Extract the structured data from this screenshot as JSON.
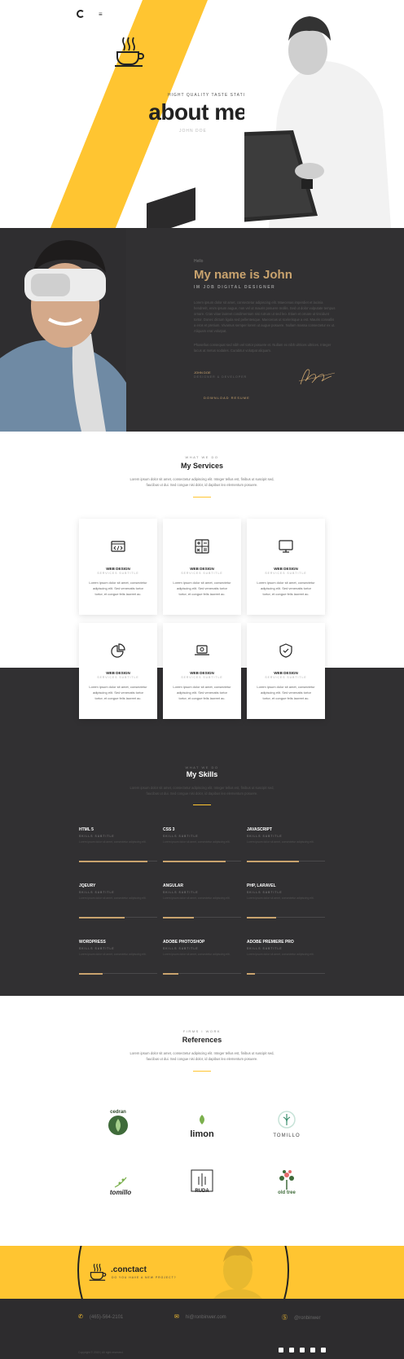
{
  "hero": {
    "menu_icon": "≡",
    "tagline": "HIGHT QUALITY TASTE STATION",
    "title_dot": ".",
    "title": "about me",
    "subtitle": "JOHN DOE"
  },
  "about": {
    "hello": "Hello",
    "name": "My name is John",
    "role": "IM JOB DIGITAL DESIGNER",
    "para1": "Lorem ipsum dolor sit amet, consectetur adipiscing elit. Maecenas imperdiet et lacinia hendrerit, enim ipsum augue, non vel ut mauris posuere mollis. Sed ut dolor vulputate tempus ornare. Cras vitae laoreet condimentum nisi rutrum ut sed leo. Etiam et ornare ut tincidunt tortor. Donec dictum ligula sed pellentesque. Maecenas ut scelerisque a est. Mauris convallis a eros et pretium. Vivamus semper lorem ut augue posuere. Nullam massa consectetur ex ut. Aliquam erat volutpat.",
    "para2": "Phasellus consequat sed nibh vel tortor posuere et. Nullam ex nibh ultrices ultrices. Integer lacus at metus sodales. Curabitur volutpat aliquam.",
    "sig_name": "JOHN DOE",
    "sig_role": "DESIGNER & DEVELOPER",
    "download": "DOWNLOAD RESUME"
  },
  "services": {
    "kicker": "WHAT WE DO",
    "title": "My Services",
    "desc": "Lorem ipsum dolor sit amet, consectetur adipiscing elit. Integer tellus est, finibus ut suscipit sed, faucibus ut dui. Sed congue nisi dolor, id dapibus leo elementum posuere.",
    "items": [
      {
        "icon": "code-icon",
        "title": "WEB DESIGN",
        "subtitle": "SERVICES SUBTITLE",
        "desc": "Lorem ipsum dolor sit amet, consectetur adipiscing elit. Sed venenatis tortor tortor, et congue felis laoreet ac."
      },
      {
        "icon": "calculator-icon",
        "title": "WEB DESIGN",
        "subtitle": "SERVICES SUBTITLE",
        "desc": "Lorem ipsum dolor sit amet, consectetur adipiscing elit. Sed venenatis tortor tortor, et congue felis laoreet ac."
      },
      {
        "icon": "monitor-icon",
        "title": "WEB DESIGN",
        "subtitle": "SERVICES SUBTITLE",
        "desc": "Lorem ipsum dolor sit amet, consectetur adipiscing elit. Sed venenatis tortor tortor, et congue felis laoreet ac."
      },
      {
        "icon": "pie-chart-icon",
        "title": "WEB DESIGN",
        "subtitle": "SERVICES SUBTITLE",
        "desc": "Lorem ipsum dolor sit amet, consectetur adipiscing elit. Sed venenatis tortor tortor, et congue felis laoreet ac."
      },
      {
        "icon": "laptop-gear-icon",
        "title": "WEB DESIGN",
        "subtitle": "SERVICES SUBTITLE",
        "desc": "Lorem ipsum dolor sit amet, consectetur adipiscing elit. Sed venenatis tortor tortor, et congue felis laoreet ac."
      },
      {
        "icon": "shield-check-icon",
        "title": "WEB DESIGN",
        "subtitle": "SERVICES SUBTITLE",
        "desc": "Lorem ipsum dolor sit amet, consectetur adipiscing elit. Sed venenatis tortor tortor, et congue felis laoreet ac."
      }
    ]
  },
  "skills": {
    "kicker": "WHAT WE DO",
    "title": "My Skills",
    "desc": "Lorem ipsum dolor sit amet, consectetur adipiscing elit. Integer tellus est, finibus ut suscipit sed, faucibus ut dui. Sed congue nisi dolor, id dapibus leo elementum posuere.",
    "items": [
      {
        "name": "HTML 5",
        "subtitle": "SKILLS SUBTITLE",
        "desc": "Lorem ipsum dolor sit amet, consectetur adipiscing elit.",
        "level": 0.88
      },
      {
        "name": "CSS 3",
        "subtitle": "SKILLS SUBTITLE",
        "desc": "Lorem ipsum dolor sit amet, consectetur adipiscing elit.",
        "level": 0.8
      },
      {
        "name": "JAVASCRIPT",
        "subtitle": "SKILLS SUBTITLE",
        "desc": "Lorem ipsum dolor sit amet, consectetur adipiscing elit.",
        "level": 0.67
      },
      {
        "name": "JQEURY",
        "subtitle": "SKILLS SUBTITLE",
        "desc": "Lorem ipsum dolor sit amet, consectetur adipiscing elit.",
        "level": 0.58
      },
      {
        "name": "ANGULAR",
        "subtitle": "SKILLS SUBTITLE",
        "desc": "Lorem ipsum dolor sit amet, consectetur adipiscing elit.",
        "level": 0.4
      },
      {
        "name": "PHP, LARAVEL",
        "subtitle": "SKILLS SUBTITLE",
        "desc": "Lorem ipsum dolor sit amet, consectetur adipiscing elit.",
        "level": 0.38
      },
      {
        "name": "WORDPRESS",
        "subtitle": "SKILLS SUBTITLE",
        "desc": "Lorem ipsum dolor sit amet, consectetur adipiscing elit.",
        "level": 0.3
      },
      {
        "name": "ADOBE PHOTOSHOP",
        "subtitle": "SKILLS SUBTITLE",
        "desc": "Lorem ipsum dolor sit amet, consectetur adipiscing elit.",
        "level": 0.2
      },
      {
        "name": "ADOBE PREMIERE PRO",
        "subtitle": "SKILLS SUBTITLE",
        "desc": "Lorem ipsum dolor sit amet, consectetur adipiscing elit.",
        "level": 0.1
      }
    ]
  },
  "references": {
    "kicker": "FIRMS I WORK",
    "title": "References",
    "desc": "Lorem ipsum dolor sit amet, consectetur adipiscing elit. Integer tellus est, finibus ut suscipit sed, faucibus ut dui. Sed congue nisi dolor, id dapibus leo elementum posuere.",
    "logos": [
      "cedran",
      "limon",
      "TOMILLO",
      "tomillo",
      "RUDA",
      "old tree"
    ]
  },
  "contact": {
    "title_dot": ".",
    "title": "conctact",
    "subtitle": "DO YOU HAVE A NEW PROJECT?"
  },
  "footer": {
    "phone": "(465)-564-2101",
    "email": "hi@ronbinwer.com",
    "skype": "@ronbinwer",
    "copy": "Copyright © 2019 | All right reserved.",
    "social": [
      "twitter-icon",
      "facebook-icon",
      "instagram-icon",
      "linkedin-icon",
      "youtube-icon"
    ]
  },
  "colors": {
    "accent": "#ffc531",
    "gold": "#c9a36e",
    "dark": "#313032"
  }
}
